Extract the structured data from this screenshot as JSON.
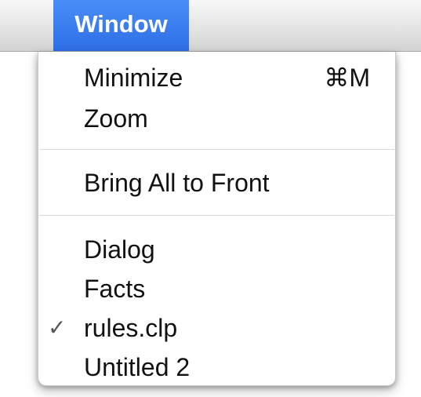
{
  "menubar": {
    "title": "Window"
  },
  "menu": {
    "items": [
      {
        "label": "Minimize",
        "shortcut": "⌘M"
      },
      {
        "label": "Zoom"
      },
      {
        "label": "Bring All to Front"
      },
      {
        "label": "Dialog"
      },
      {
        "label": "Facts"
      },
      {
        "label": "rules.clp",
        "checked": true,
        "check_glyph": "✓"
      },
      {
        "label": "Untitled 2"
      }
    ]
  },
  "colors": {
    "selection_blue": "#3b7ef0",
    "menu_text": "#111111",
    "separator": "#d9d9d9"
  }
}
